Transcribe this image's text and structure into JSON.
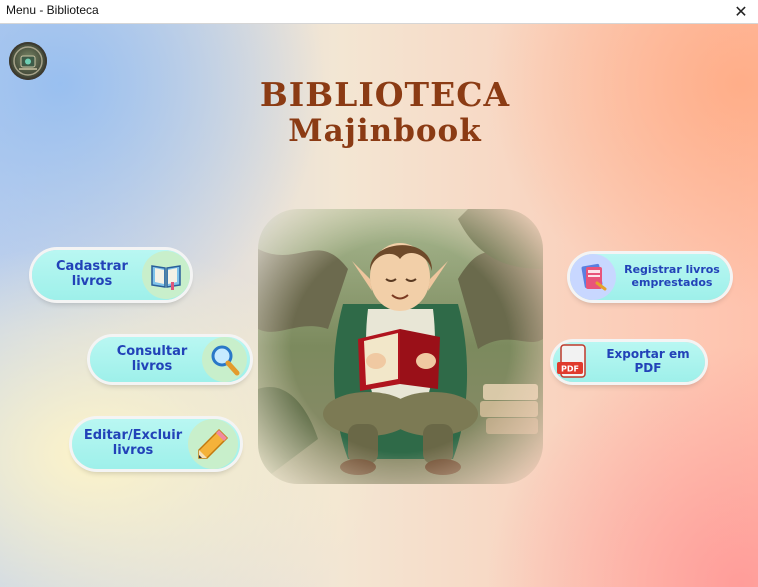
{
  "window": {
    "title": "Menu - Biblioteca",
    "close_glyph": "✕"
  },
  "header": {
    "title_line1": "BIBLIOTECA",
    "title_line2": "Majinbook"
  },
  "menu": {
    "cadastrar": {
      "line1": "Cadastrar",
      "line2": "livros",
      "icon": "open-book-icon"
    },
    "consultar": {
      "line1": "Consultar",
      "line2": "livros",
      "icon": "magnifier-icon"
    },
    "editar": {
      "line1": "Editar/Excluir",
      "line2": "livros",
      "icon": "pencil-icon"
    },
    "registrar": {
      "line1": "Registrar livros",
      "line2": "emprestados",
      "icon": "book-stack-icon"
    },
    "exportar": {
      "line1": "Exportar em",
      "line2": "PDF",
      "icon": "pdf-file-icon",
      "icon_text": "PDF"
    }
  },
  "colors": {
    "title": "#8b3b14",
    "button_fill": "#a9f2ec",
    "button_text": "#2242b8"
  }
}
